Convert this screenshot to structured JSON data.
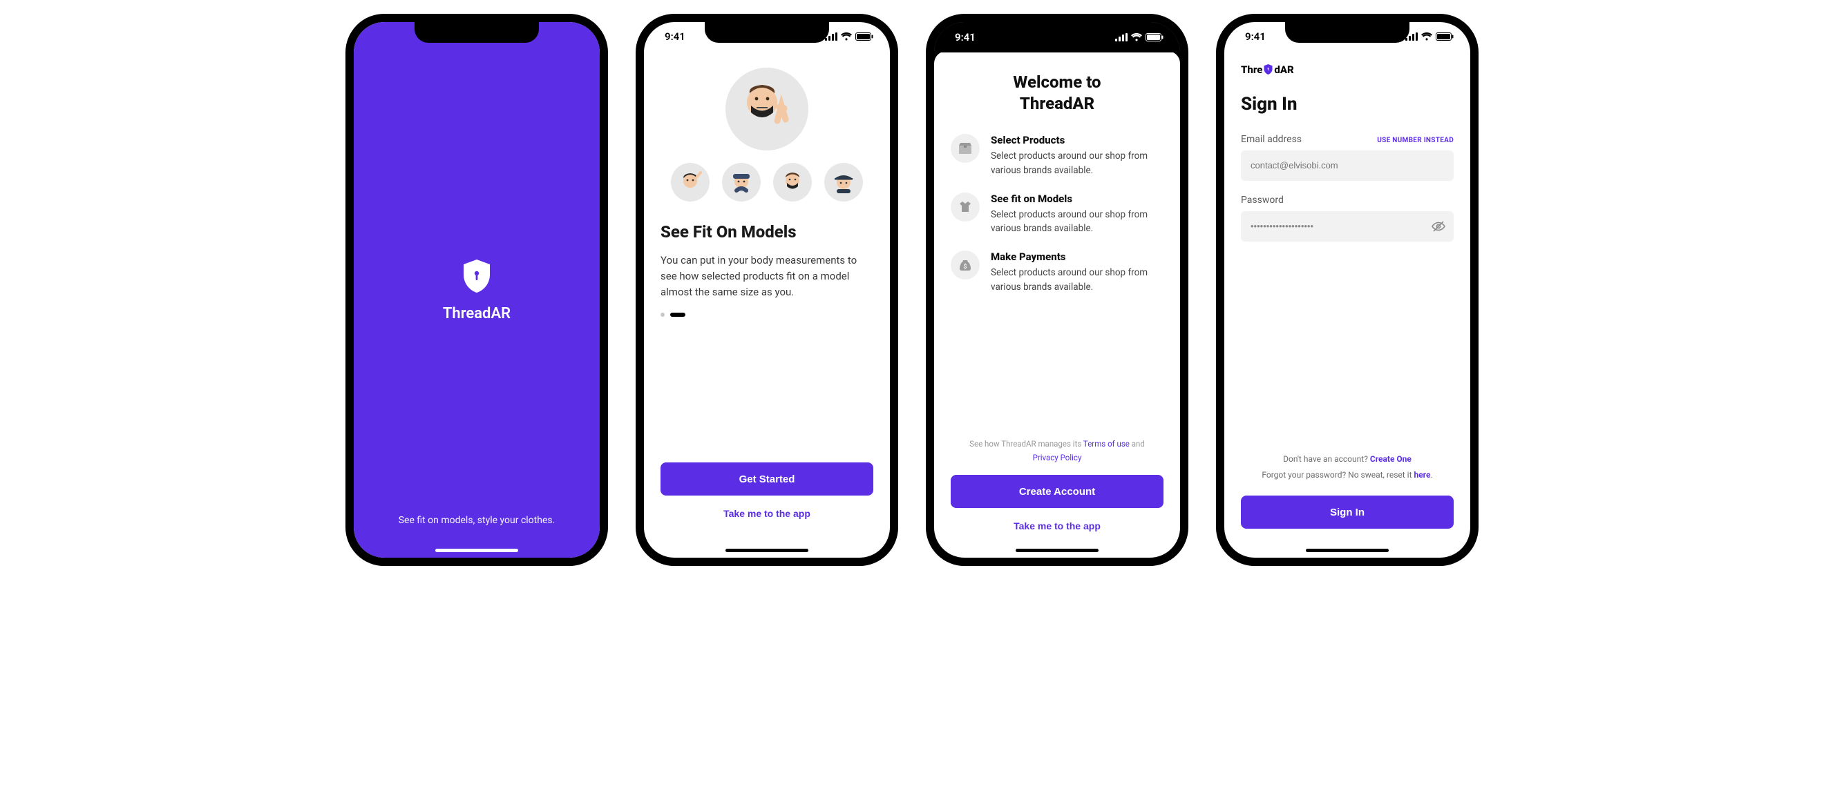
{
  "status": {
    "time": "9:41"
  },
  "theme": {
    "primary": "#5b2ee6",
    "surface": "#ffffff",
    "muted_bg": "#f2f2f2",
    "feature_icon_bg": "#efefef"
  },
  "splash": {
    "app_name": "ThreadAR",
    "tagline": "See fit on models, style your clothes."
  },
  "onboarding": {
    "title": "See Fit On Models",
    "body": "You can put in your body measurements to see how selected products fit on a model almost the same size as you.",
    "pager": {
      "count": 2,
      "active_index": 1
    },
    "cta_primary": "Get Started",
    "cta_secondary": "Take me to the app",
    "avatars": [
      "memoji-mask-peace",
      "memoji-wave",
      "memoji-heart",
      "memoji-mask",
      "memoji-cap"
    ]
  },
  "welcome": {
    "title_line1": "Welcome to",
    "title_line2": "ThreadAR",
    "features": [
      {
        "icon": "box-icon",
        "title": "Select Products",
        "desc": "Select products around our shop from various brands available."
      },
      {
        "icon": "shirt-icon",
        "title": "See fit on Models",
        "desc": "Select products around our shop from various brands available."
      },
      {
        "icon": "money-icon",
        "title": "Make Payments",
        "desc": "Select products around our shop from various brands available."
      }
    ],
    "legal_prefix": "See how ThreadAR manages its ",
    "terms_label": "Terms of use",
    "legal_and": " and",
    "privacy_label": "Privacy Policy",
    "cta_primary": "Create Account",
    "cta_secondary": "Take me to the app"
  },
  "signin": {
    "brand_pre": "Thre",
    "brand_post": "dAR",
    "title": "Sign In",
    "email_label": "Email address",
    "use_number_label": "USE NUMBER INSTEAD",
    "email_placeholder": "contact@elvisobi.com",
    "password_label": "Password",
    "password_value": "••••••••••••••••••••",
    "helper_noaccount_prefix": "Don't have an account? ",
    "helper_noaccount_link": "Create One",
    "helper_forgot_prefix": "Forgot your password? No sweat, reset it ",
    "helper_forgot_link": "here",
    "helper_forgot_suffix": ".",
    "cta": "Sign In"
  }
}
